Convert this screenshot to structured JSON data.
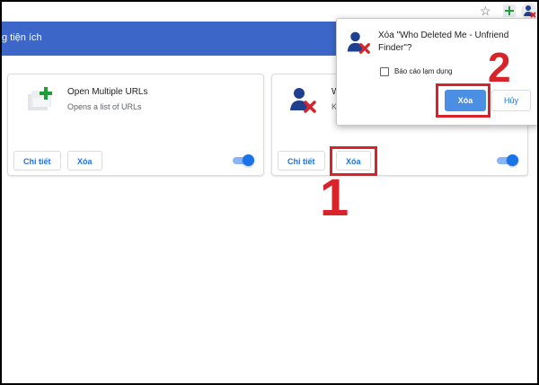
{
  "header": {
    "title": "g tiện ích"
  },
  "toolbar": {
    "star_icon": "☆"
  },
  "extensions": [
    {
      "name": "Open Multiple URLs",
      "description": "Opens a list of URLs",
      "details_label": "Chi tiết",
      "remove_label": "Xóa",
      "enabled": true,
      "icon": "open-multiple-urls-icon"
    },
    {
      "name": "W",
      "description": "K",
      "details_label": "Chi tiết",
      "remove_label": "Xóa",
      "enabled": true,
      "icon": "who-deleted-me-icon"
    }
  ],
  "dialog": {
    "title": "Xóa \"Who Deleted Me - Unfriend Finder\"?",
    "report_label": "Báo cáo lạm dụng",
    "report_checked": false,
    "confirm_label": "Xóa",
    "cancel_label": "Hủy"
  },
  "annotations": {
    "step1": "1",
    "step2": "2",
    "highlight_color": "#d9232a"
  },
  "colors": {
    "header_blue": "#3c66c8",
    "accent": "#1a73e8"
  }
}
